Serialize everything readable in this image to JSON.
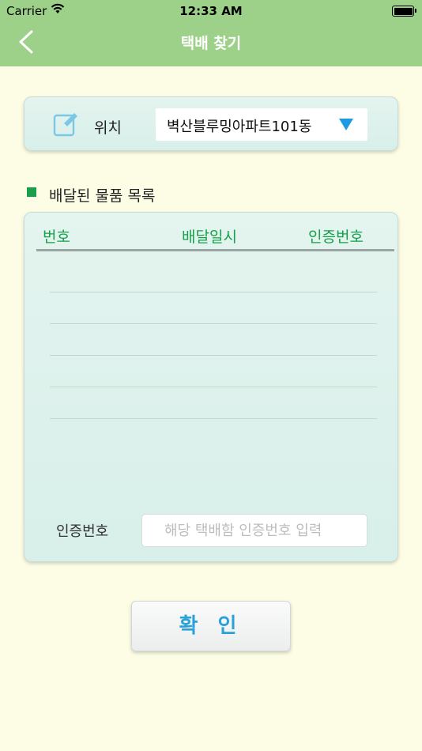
{
  "status_bar": {
    "carrier": "Carrier",
    "time": "12:33 AM"
  },
  "nav": {
    "title": "택배 찾기",
    "back_icon": "chevron-left-icon"
  },
  "location": {
    "label": "위치",
    "icon": "edit-icon",
    "selected": "벽산블루밍아파트101동",
    "dropdown_icon": "triangle-down-icon"
  },
  "delivered_list": {
    "section_title": "배달된 물품 목록",
    "columns": [
      "번호",
      "배달일시",
      "인증번호"
    ],
    "rows": []
  },
  "auth": {
    "label": "인증번호",
    "placeholder": "해당 택배함 인증번호 입력",
    "value": ""
  },
  "confirm_label": "확 인",
  "colors": {
    "nav_bar": "#9dd18a",
    "background": "#fdfde6",
    "accent_green": "#14a14b",
    "accent_blue": "#2aa1d9"
  }
}
